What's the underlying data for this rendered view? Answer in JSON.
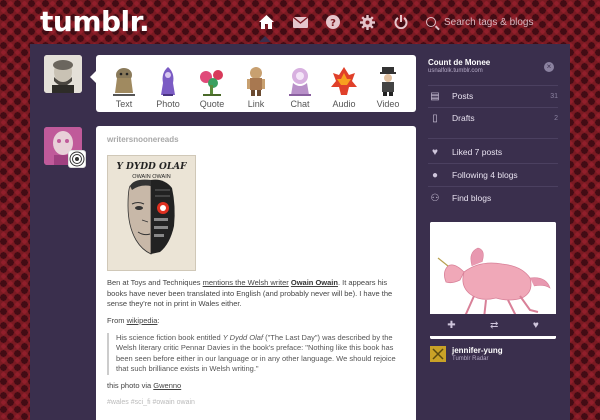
{
  "header": {
    "logo": "tumblr.",
    "search_placeholder": "Search tags & blogs",
    "nav": [
      {
        "name": "dashboard",
        "icon": "home-icon"
      },
      {
        "name": "messages",
        "icon": "envelope-icon"
      },
      {
        "name": "help",
        "icon": "help-icon"
      },
      {
        "name": "settings",
        "icon": "gear-icon"
      },
      {
        "name": "logout",
        "icon": "power-icon"
      }
    ]
  },
  "post_types": [
    {
      "label": "Text"
    },
    {
      "label": "Photo"
    },
    {
      "label": "Quote"
    },
    {
      "label": "Link"
    },
    {
      "label": "Chat"
    },
    {
      "label": "Audio"
    },
    {
      "label": "Video"
    }
  ],
  "post": {
    "author": "writersnoonereads",
    "book_title": "Y DYDD OLAF",
    "book_author": "OWAIN OWAIN",
    "p1_a": "Ben at Toys and Techniques ",
    "p1_link": "mentions the Welsh writer",
    "p1_b": " ",
    "p1_bold": "Owain Owain",
    "p1_c": ". It appears his books have never been translated into English (and probably never will be). I have the sense they're not in print in Wales either.",
    "p2_a": "From ",
    "p2_link": "wikipedia",
    "p2_b": ":",
    "q_a": "His science fiction book entitled ",
    "q_title": "Y Dydd Olaf",
    "q_b": " (\"The Last Day\") was described by the Welsh literary critic Pennar Davies in the book's preface: \"Nothing like this book has been seen before either in our language or in any other language. We should rejoice that such brilliance exists in Welsh writing.\"",
    "p3_a": "this photo via ",
    "p3_link": "Gwenno",
    "tags": "#wales   #sci_fi   #owain owain"
  },
  "sidebar": {
    "blog_title": "Count de Monee",
    "blog_url": "usnalfolk.tumblr.com",
    "items": [
      {
        "label": "Posts",
        "icon": "posts-icon",
        "count": "31"
      },
      {
        "label": "Drafts",
        "icon": "drafts-icon",
        "count": "2"
      },
      {
        "label": "Liked 7 posts",
        "icon": "heart-icon",
        "count": ""
      },
      {
        "label": "Following 4 blogs",
        "icon": "person-icon",
        "count": ""
      },
      {
        "label": "Find blogs",
        "icon": "people-icon",
        "count": ""
      }
    ],
    "radar_user": "jennifer-yung",
    "radar_label": "Tumblr Radar"
  },
  "colors": {
    "accent_dark": "#3a2f4d",
    "background": "#7a1a22"
  }
}
